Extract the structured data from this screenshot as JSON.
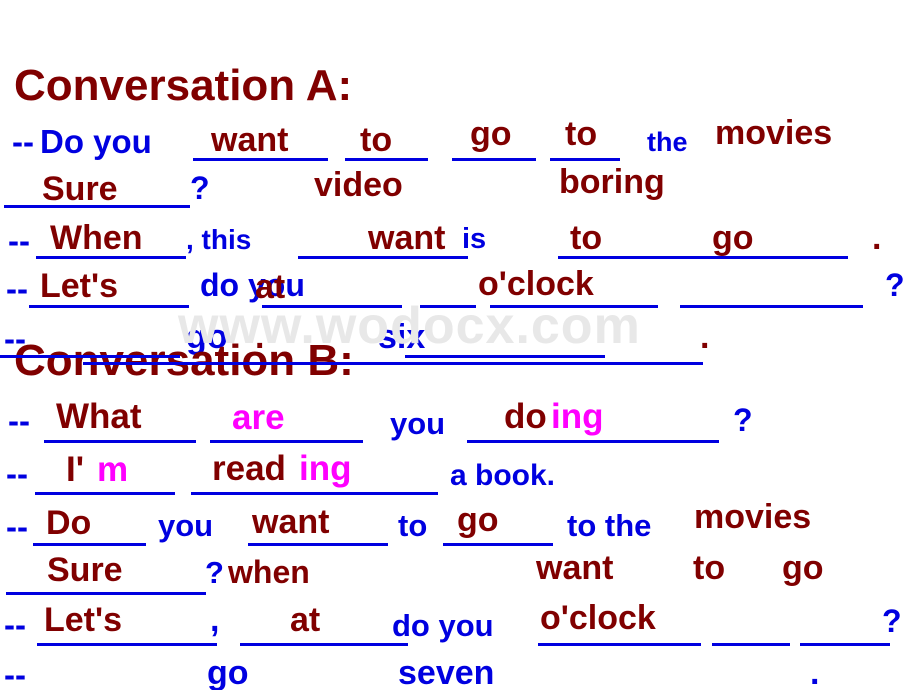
{
  "slide": {
    "background_color": "#ffffff",
    "colors": {
      "dark_red": "#800000",
      "blue": "#0000E0",
      "magenta": "#FF00FF",
      "watermark_gray": "#E8E8E8",
      "underline_blue": "#0000E0"
    },
    "watermark": "www.wodocx.com",
    "headings": {
      "conversation_a": "Conversation A:",
      "conversation_b": "Conversation B:"
    },
    "tokens": {
      "dash": "--",
      "do_you": "Do you",
      "want": "want",
      "to": "to",
      "go": "go",
      "the": "the",
      "movies": "movies",
      "sure": "Sure",
      "question_mark": "?",
      "video": "video",
      "when_cap": "When",
      "comma_this": ", this",
      "is": "is",
      "boring": "boring",
      "period": ".",
      "lets": "Let's",
      "do_you_lc": "do you",
      "at": "at",
      "oclock": "o'clock",
      "six": "six",
      "what": "What",
      "are": "are",
      "you": "you",
      "do_stem": "do",
      "ing": "ing",
      "im_stem": "I'",
      "im_suffix": "m",
      "read_stem": "read",
      "a_book": "a book.",
      "do_cap": "Do",
      "to_the": "to the",
      "when_lc": "when",
      "comma": ",",
      "do_you_blue": "do you",
      "seven": "seven",
      "go_blue": "go"
    },
    "conversation_a_lines": [
      "--Do you ______ want ____ to ____ go ____ to ___ the movies",
      "____ Sure ____ ? video boring",
      "-- ____ When ____ , this ________ want is ____ to ____ go ____ .",
      "-- ________ Let's ____ do you at ________ o'clock ________ ?",
      "-- ________ go . six ____________ ."
    ],
    "conversation_b_lines": [
      "-- ______ What ______ are ______ you __________ doing _______ ?",
      "-- ______ I'm ____________ reading _______ a book.",
      "-- ____ Do ____ you ______ want ____ to ____ go ____ to the movies",
      "________ Sure ________ ? when want to go",
      "-- ________ Let's ____ , ________ at ____ do you ________ o'clock _____ ____ ?",
      "-- go seven ."
    ]
  }
}
